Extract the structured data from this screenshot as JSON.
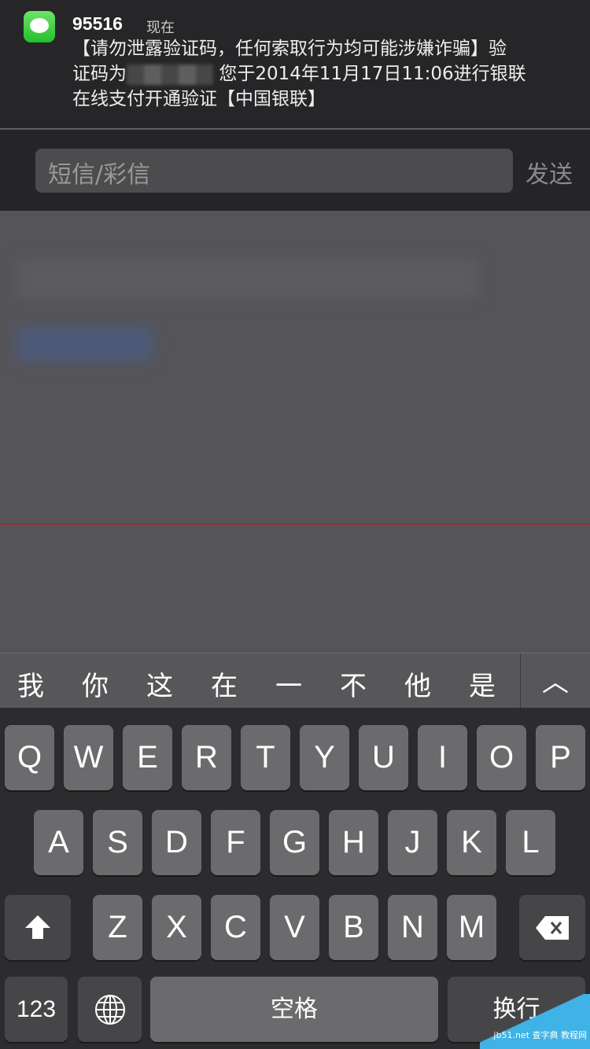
{
  "notification": {
    "app_icon": "messages-icon",
    "sender": "95516",
    "time": "现在",
    "message": [
      "【请勿泄露验证码，任何索取行为均可能涉嫌诈骗】验",
      "证码为",
      "您于2014年11月17日11:06进行银联",
      "在线支付开通验证【中国银联】"
    ]
  },
  "reply": {
    "placeholder": "短信/彩信",
    "send_label": "发送"
  },
  "candidates": {
    "items": [
      "我",
      "你",
      "这",
      "在",
      "一",
      "不",
      "他",
      "是"
    ],
    "expand_icon": "chevron-up-icon"
  },
  "keyboard": {
    "row1": [
      "Q",
      "W",
      "E",
      "R",
      "T",
      "Y",
      "U",
      "I",
      "O",
      "P"
    ],
    "row2": [
      "A",
      "S",
      "D",
      "F",
      "G",
      "H",
      "J",
      "K",
      "L"
    ],
    "row3": [
      "Z",
      "X",
      "C",
      "V",
      "B",
      "N",
      "M"
    ],
    "shift_icon": "shift-icon",
    "delete_icon": "backspace-icon",
    "numbers_label": "123",
    "globe_icon": "globe-icon",
    "space_label": "空格",
    "return_label": "换行"
  },
  "watermark": "jb51.net 查字典 教程网"
}
